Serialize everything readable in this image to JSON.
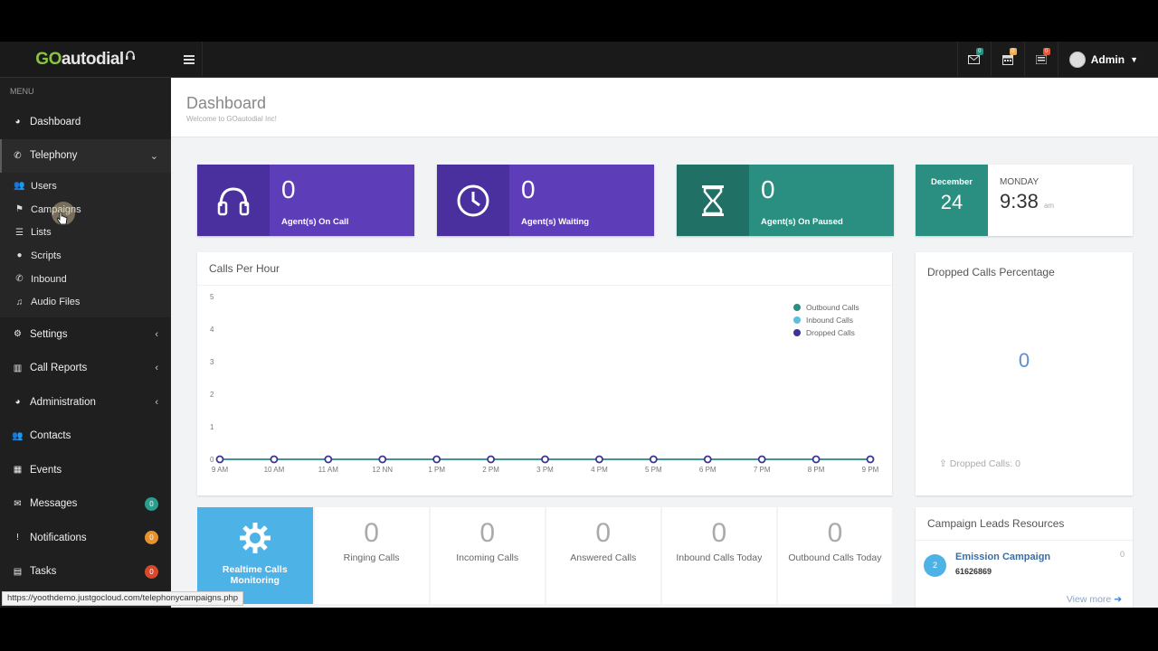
{
  "brand": {
    "go": "GO",
    "rest": "autodial"
  },
  "topbar": {
    "menu_icon": "hamburger-icon",
    "icons": [
      {
        "name": "envelope-icon",
        "badge": "0",
        "color": "#2a8f80"
      },
      {
        "name": "calendar-icon",
        "badge": "0",
        "color": "#f0ad4e"
      },
      {
        "name": "tasks-icon",
        "badge": "0",
        "color": "#e05a3a"
      }
    ],
    "user": "Admin"
  },
  "sidebar": {
    "menu_label": "MENU",
    "dashboard": "Dashboard",
    "telephony": "Telephony",
    "telephony_sub": [
      "Users",
      "Campaigns",
      "Lists",
      "Scripts",
      "Inbound",
      "Audio Files"
    ],
    "settings": "Settings",
    "call_reports": "Call Reports",
    "administration": "Administration",
    "contacts": "Contacts",
    "events": "Events",
    "messages": "Messages",
    "messages_badge": "0",
    "notifications": "Notifications",
    "notifications_badge": "0",
    "tasks": "Tasks",
    "tasks_badge": "0"
  },
  "status_url": "https://yoothdemo.justgocloud.com/telephonycampaigns.php",
  "header": {
    "title": "Dashboard",
    "subtitle": "Welcome to GOautodial Inc!"
  },
  "stats": [
    {
      "value": "0",
      "label": "Agent(s) On Call",
      "icon": "headphones-icon"
    },
    {
      "value": "0",
      "label": "Agent(s) Waiting",
      "icon": "clock-icon"
    },
    {
      "value": "0",
      "label": "Agent(s) On Paused",
      "icon": "hourglass-icon"
    }
  ],
  "date": {
    "month": "December",
    "day": "24",
    "weekday": "MONDAY",
    "time": "9:38",
    "ampm": "am"
  },
  "calls_per_hour": {
    "title": "Calls Per Hour"
  },
  "chart_data": {
    "type": "line",
    "title": "Calls Per Hour",
    "x": [
      "9 AM",
      "10 AM",
      "11 AM",
      "12 NN",
      "1 PM",
      "2 PM",
      "3 PM",
      "4 PM",
      "5 PM",
      "6 PM",
      "7 PM",
      "8 PM",
      "9 PM"
    ],
    "ylim": [
      0,
      5
    ],
    "yticks": [
      "0",
      "1",
      "2",
      "3",
      "4",
      "5"
    ],
    "series": [
      {
        "name": "Outbound Calls",
        "color": "#2a8f80",
        "values": [
          0,
          0,
          0,
          0,
          0,
          0,
          0,
          0,
          0,
          0,
          0,
          0,
          0
        ]
      },
      {
        "name": "Inbound Calls",
        "color": "#5bc0de",
        "values": [
          0,
          0,
          0,
          0,
          0,
          0,
          0,
          0,
          0,
          0,
          0,
          0,
          0
        ]
      },
      {
        "name": "Dropped Calls",
        "color": "#3a3597",
        "values": [
          0,
          0,
          0,
          0,
          0,
          0,
          0,
          0,
          0,
          0,
          0,
          0,
          0
        ]
      }
    ],
    "legend": "top-right",
    "grid": false
  },
  "dropped": {
    "title": "Dropped Calls Percentage",
    "value": "0",
    "footer": "Dropped Calls: 0"
  },
  "realtime": {
    "label": "Realtime Calls Monitoring"
  },
  "tiles": [
    {
      "value": "0",
      "label": "Ringing Calls"
    },
    {
      "value": "0",
      "label": "Incoming Calls"
    },
    {
      "value": "0",
      "label": "Answered Calls"
    },
    {
      "value": "0",
      "label": "Inbound Calls Today"
    },
    {
      "value": "0",
      "label": "Outbound Calls Today"
    }
  ],
  "leads": {
    "title": "Campaign Leads Resources",
    "items": [
      {
        "badge": "2",
        "name": "Emission Campaign",
        "id": "61626869",
        "count": "0"
      }
    ],
    "view_more": "View more"
  }
}
